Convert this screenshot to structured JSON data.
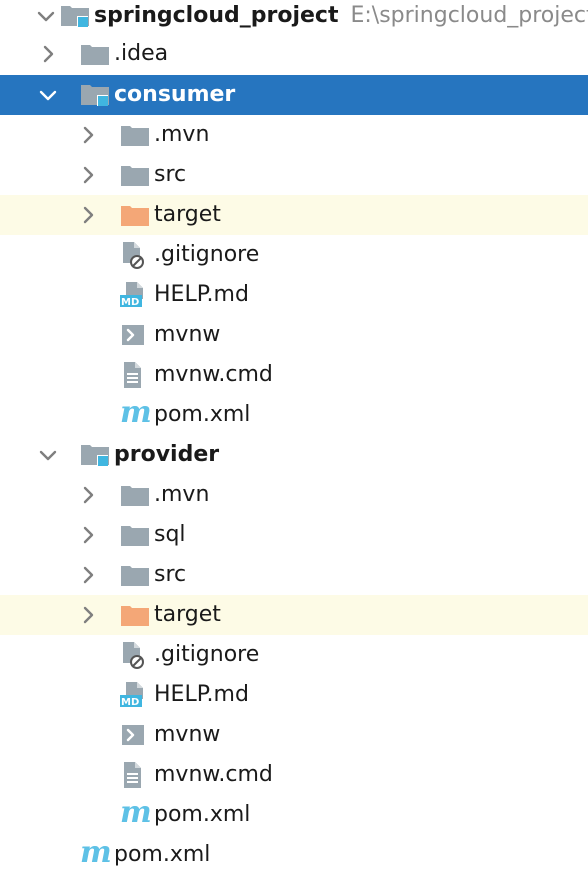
{
  "colors": {
    "selection": "#2675bf",
    "ignored_row": "#fdfbe6",
    "folder": "#9aa7b0",
    "excluded_folder": "#f4a777",
    "module_badge": "#40b6e0",
    "maven": "#5ec1e6"
  },
  "tree": {
    "root": {
      "label": "springcloud_project",
      "path": "E:\\springcloud_project",
      "icon": "module-folder-icon",
      "expanded": true
    },
    "idea": {
      "label": ".idea",
      "icon": "folder-icon",
      "expanded": false
    },
    "consumer": {
      "label": "consumer",
      "icon": "module-folder-icon",
      "expanded": true,
      "selected": true,
      "children": {
        "mvn": ".mvn",
        "src": "src",
        "target": "target",
        "gitignore": ".gitignore",
        "help": "HELP.md",
        "mvnw": "mvnw",
        "mvnw_cmd": "mvnw.cmd",
        "pom": "pom.xml"
      }
    },
    "provider": {
      "label": "provider",
      "icon": "module-folder-icon",
      "expanded": true,
      "children": {
        "mvn": ".mvn",
        "sql": "sql",
        "src": "src",
        "target": "target",
        "gitignore": ".gitignore",
        "help": "HELP.md",
        "mvnw": "mvnw",
        "mvnw_cmd": "mvnw.cmd",
        "pom": "pom.xml"
      }
    },
    "root_pom": "pom.xml",
    "md_badge": "MD",
    "maven_glyph": "m"
  }
}
